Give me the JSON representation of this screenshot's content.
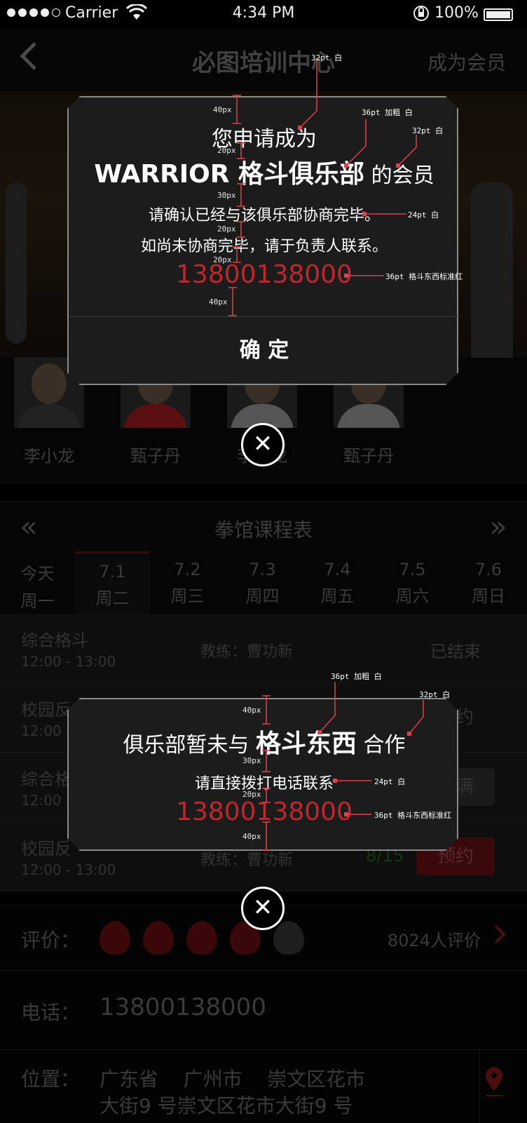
{
  "status_bar": {
    "carrier": "Carrier",
    "time": "4:34 PM",
    "battery": "100%"
  },
  "nav": {
    "back_icon": "chevron-left-icon",
    "title": "必图培训中心",
    "right_action": "成为会员"
  },
  "coaches": [
    {
      "name": "李小龙"
    },
    {
      "name": "甄子丹"
    },
    {
      "name": "李小龙"
    },
    {
      "name": "甄子丹"
    }
  ],
  "schedule": {
    "title": "拳馆课程表",
    "days": [
      {
        "date": "今天",
        "weekday": "周一"
      },
      {
        "date": "7.1",
        "weekday": "周二"
      },
      {
        "date": "7.2",
        "weekday": "周三"
      },
      {
        "date": "7.3",
        "weekday": "周四"
      },
      {
        "date": "7.4",
        "weekday": "周五"
      },
      {
        "date": "7.5",
        "weekday": "周六"
      },
      {
        "date": "7.6",
        "weekday": "周日"
      }
    ],
    "classes": [
      {
        "name": "综合格斗",
        "time": "12:00 - 13:00",
        "coach": "教练：曹功新",
        "status": "已结束"
      },
      {
        "name": "校园反",
        "time": "12:00 - 13:00",
        "coach": "",
        "status": "预约"
      },
      {
        "name": "综合格",
        "time": "12:00 - 13:00",
        "coach": "",
        "status": "已满"
      },
      {
        "name": "校园反",
        "time": "12:00 - 13:00",
        "coach": "教练：曹功新",
        "count": "8/15",
        "status": "预约"
      }
    ]
  },
  "info": {
    "rating_label": "评价：",
    "rating_count": "8024人评价",
    "phone_label": "电话：",
    "phone": "13800138000",
    "location_label": "位置：",
    "location_line1": "广东省    广州市    崇文区花市",
    "location_line2": "大街9 号崇文区花市大街9 号"
  },
  "dialog1": {
    "line1": "您申请成为",
    "club": "WARRIOR 格斗俱乐部",
    "suffix": " 的会员",
    "line3": "请确认已经与该俱乐部协商完毕。",
    "line4": "如尚未协商完毕，请于负责人联系。",
    "phone": "13800138000",
    "confirm": "确 定"
  },
  "dialog2": {
    "prefix": "俱乐部暂未与 ",
    "brand": "格斗东西",
    "suffix": " 合作",
    "line2": "请直接拨打电话联系",
    "phone": "13800138000"
  },
  "annotations": {
    "a32_white": "32pt 白",
    "a36_bold_white": "36pt 加粗 白",
    "a24_white": "24pt 白",
    "a36_red": "36pt 格斗东西标准红",
    "px40": "40px",
    "px20": "20px",
    "px30": "30px"
  },
  "colors": {
    "brand_red": "#c0262c",
    "annotation": "#e0404a"
  }
}
